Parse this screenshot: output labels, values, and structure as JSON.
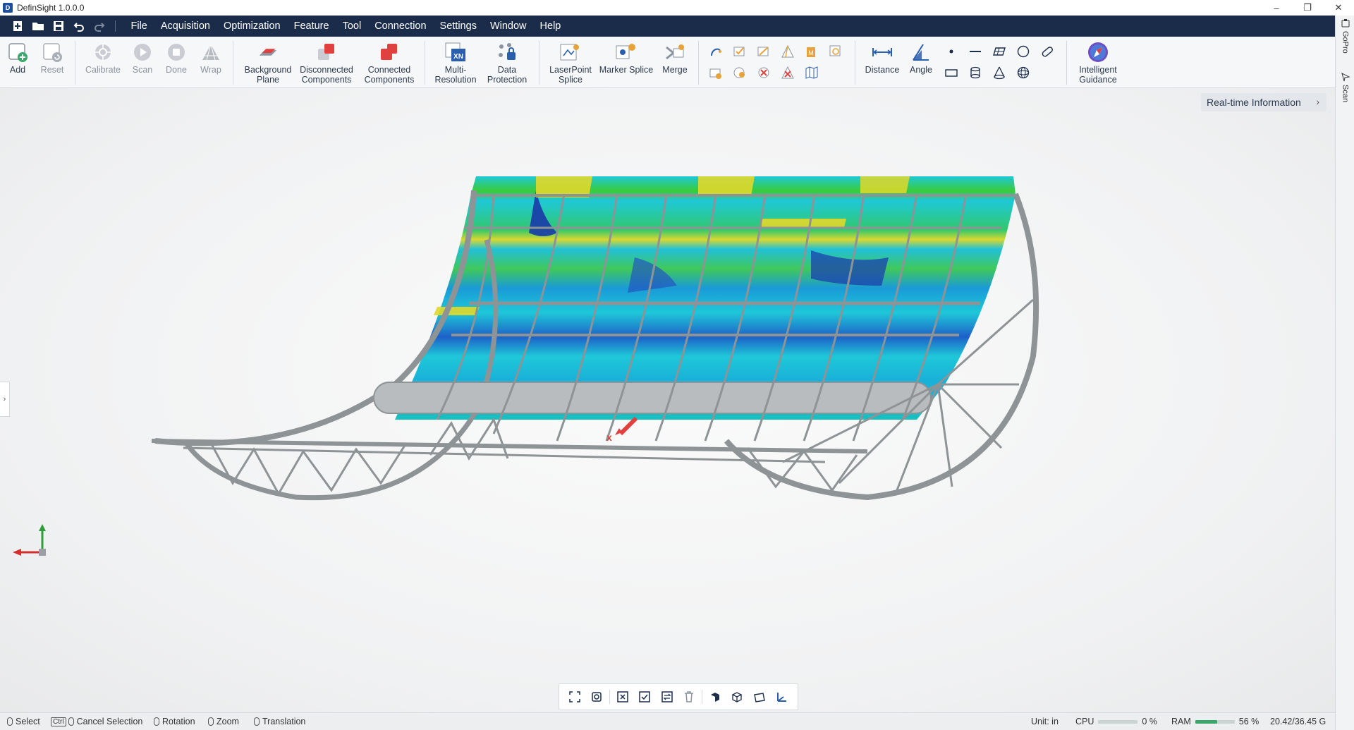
{
  "window": {
    "title": "DefinSight 1.0.0.0",
    "app_icon": "D"
  },
  "menu": {
    "items": [
      "File",
      "Acquisition",
      "Optimization",
      "Feature",
      "Tool",
      "Connection",
      "Settings",
      "Window",
      "Help"
    ],
    "quick_access_icons": [
      "new-project-icon",
      "open-folder-icon",
      "save-icon",
      "undo-icon",
      "redo-icon"
    ]
  },
  "ribbon": {
    "add": "Add",
    "reset": "Reset",
    "calibrate": "Calibrate",
    "scan": "Scan",
    "done": "Done",
    "wrap": "Wrap",
    "background_plane_1": "Background",
    "background_plane_2": "Plane",
    "disconnected_1": "Disconnected",
    "disconnected_2": "Components",
    "connected_1": "Connected",
    "connected_2": "Components",
    "multires_1": "Multi-",
    "multires_2": "Resolution",
    "dataprot_1": "Data",
    "dataprot_2": "Protection",
    "laser_1": "LaserPoint",
    "laser_2": "Splice",
    "marker_splice": "Marker Splice",
    "merge": "Merge",
    "distance": "Distance",
    "angle": "Angle",
    "intelligent_1": "Intelligent",
    "intelligent_2": "Guidance"
  },
  "viewport": {
    "realtime_info": "Real-time Information",
    "axis_colors": {
      "x": "#d32f2f",
      "y": "#2e9d3a"
    }
  },
  "right_panel": {
    "tab1": "GoPro",
    "tab2": "Scan"
  },
  "status": {
    "select": "Select",
    "ctrl_key": "Ctrl",
    "cancel_selection": "Cancel Selection",
    "rotation": "Rotation",
    "zoom": "Zoom",
    "translation": "Translation",
    "unit": "Unit: in",
    "cpu_label": "CPU",
    "cpu_value": "0 %",
    "cpu_fraction": 0.0,
    "ram_label": "RAM",
    "ram_value": "56 %",
    "ram_fraction": 0.56,
    "memory": "20.42/36.45 G"
  },
  "colors": {
    "menu_bg": "#1b2b4a",
    "accent_red": "#e0413f",
    "accent_blue": "#2a5fb0"
  }
}
